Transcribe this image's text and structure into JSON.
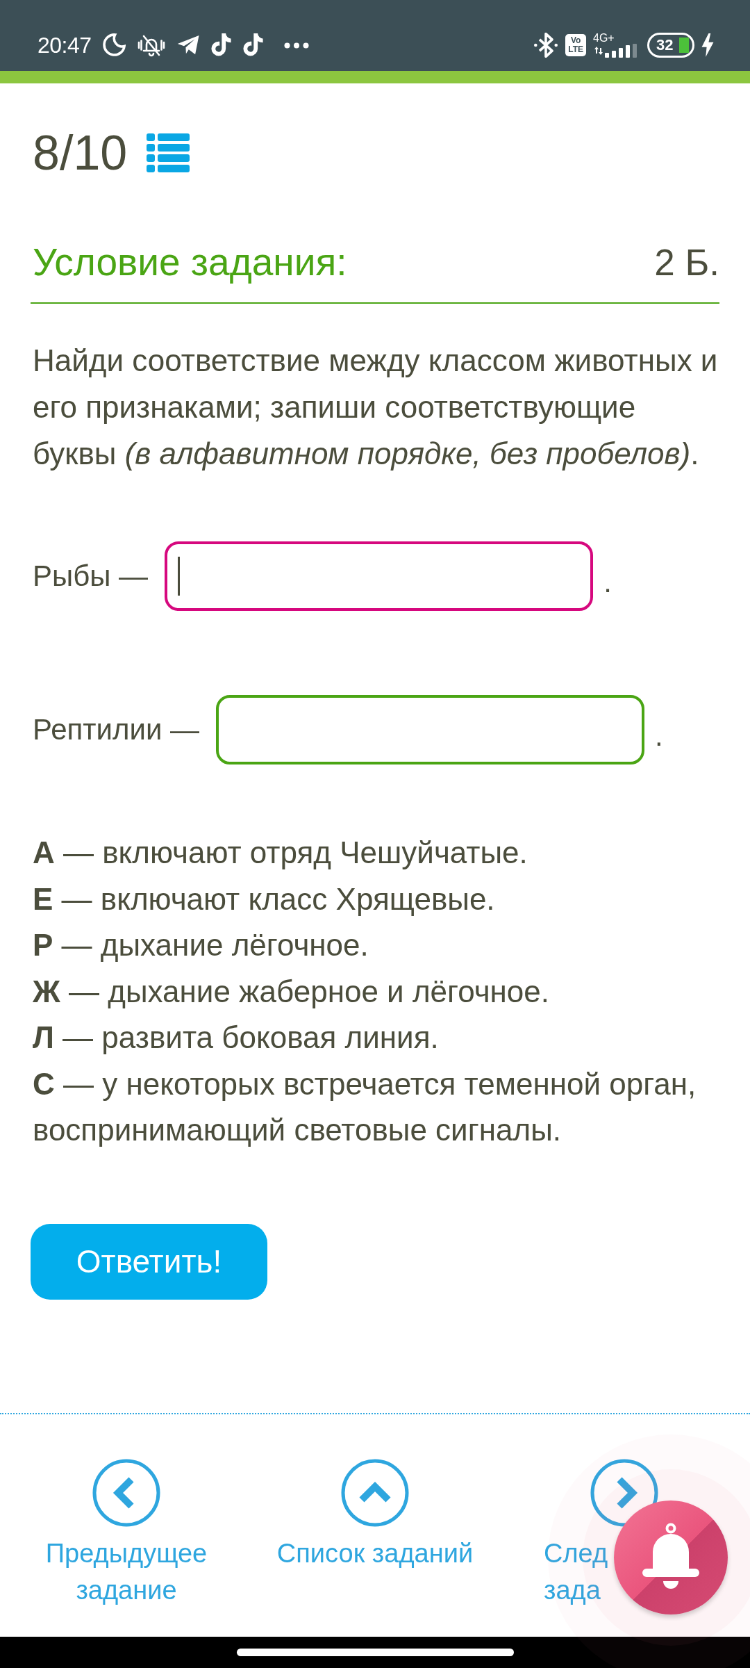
{
  "status_bar": {
    "time": "20:47",
    "badge": [
      "Vo",
      "LTE"
    ],
    "network": "4G+",
    "battery": "32"
  },
  "progress": {
    "counter": "8/10"
  },
  "task": {
    "title": "Условие задания:",
    "points": "2 Б.",
    "instruction": "Найди соответствие между классом животных и его признаками; запиши соответствующие буквы *(в алфавитном порядке, без пробелов)*."
  },
  "answers": [
    {
      "label": "Рыбы —",
      "focused": true,
      "suffix": "."
    },
    {
      "label": "Рептилии —",
      "focused": false,
      "suffix": "."
    }
  ],
  "options": [
    "**А** — включают отряд Чешуйчатые.",
    "**Е** — включают класс Хрящевые.",
    "**Р** — дыхание лёгочное.",
    "**Ж** — дыхание жаберное и лёгочное.",
    "**Л** — развита боковая линия.",
    "**С** — у некоторых встречается теменной орган, воспринимающий световые сигналы."
  ],
  "submit_button": {
    "label": "Ответить!"
  },
  "nav": [
    {
      "kind": "previous",
      "lines": [
        "Предыдущее",
        "задание"
      ]
    },
    {
      "kind": "list",
      "lines": [
        "Список заданий"
      ]
    },
    {
      "kind": "next",
      "lines": [
        "След",
        "зада"
      ]
    }
  ]
}
